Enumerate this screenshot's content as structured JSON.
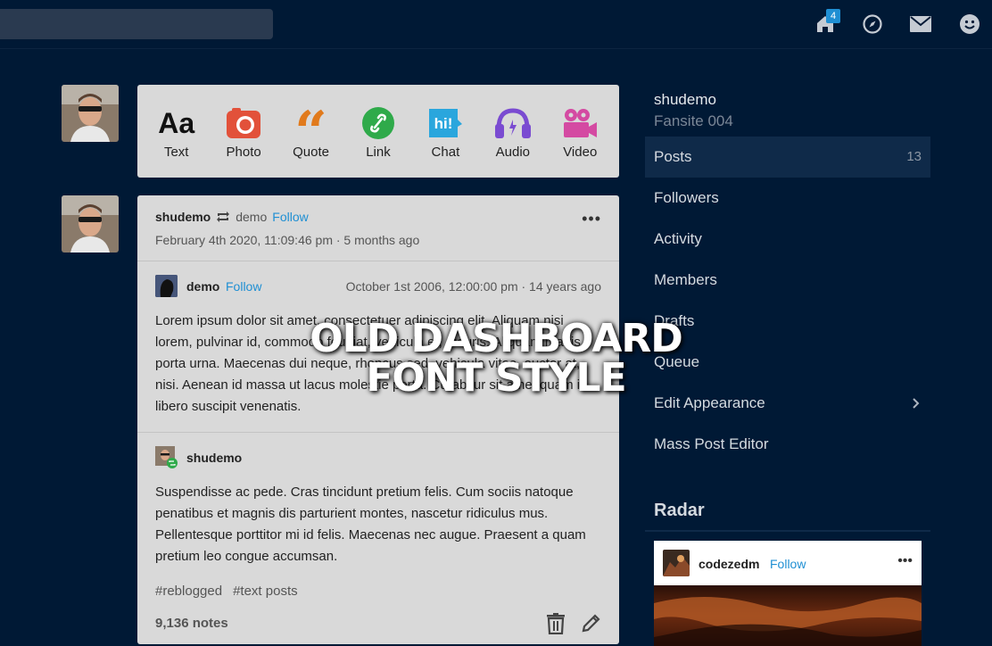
{
  "header": {
    "notification_count": "4"
  },
  "post_types": [
    {
      "label": "Text",
      "icon": "text-icon",
      "color": "#111111"
    },
    {
      "label": "Photo",
      "icon": "camera-icon",
      "color": "#e2513a"
    },
    {
      "label": "Quote",
      "icon": "quote-icon",
      "color": "#e17a1c"
    },
    {
      "label": "Link",
      "icon": "link-icon",
      "color": "#2faa4a"
    },
    {
      "label": "Chat",
      "icon": "chat-icon",
      "color": "#2aa6dd"
    },
    {
      "label": "Audio",
      "icon": "headphones-icon",
      "color": "#7a4bd1"
    },
    {
      "label": "Video",
      "icon": "video-camera-icon",
      "color": "#d44aa2"
    }
  ],
  "post": {
    "author": "shudemo",
    "reblogged_from": "demo",
    "follow_label": "Follow",
    "timestamp": "February 4th 2020, 11:09:46 pm · 5 months ago",
    "original": {
      "author": "demo",
      "follow_label": "Follow",
      "timestamp": "October 1st 2006, 12:00:00 pm · 14 years ago",
      "body": "Lorem ipsum dolor sit amet, consectetuer adipiscing elit. Aliquam nisi lorem, pulvinar id, commodo feugiat, vehicula et, mauris. Aliquam mattis porta urna. Maecenas dui neque, rhoncus sed, vehicula vitae, auctor at, nisi. Aenean id massa ut lacus molestie porta. Curabitur sit amet quam id libero suscipit venenatis."
    },
    "reblog": {
      "author": "shudemo",
      "body": "Suspendisse ac pede. Cras tincidunt pretium felis. Cum sociis natoque penatibus et magnis dis parturient montes, nascetur ridiculus mus. Pellentesque porttitor mi id felis. Maecenas nec augue. Praesent a quam pretium leo congue accumsan."
    },
    "tags": [
      "#reblogged",
      "#text posts"
    ],
    "notes": "9,136 notes"
  },
  "sidebar": {
    "blog_name": "shudemo",
    "blog_title": "Fansite 004",
    "items": [
      {
        "label": "Posts",
        "count": "13"
      },
      {
        "label": "Followers"
      },
      {
        "label": "Activity"
      },
      {
        "label": "Members"
      },
      {
        "label": "Drafts"
      },
      {
        "label": "Queue"
      },
      {
        "label": "Edit Appearance"
      },
      {
        "label": "Mass Post Editor"
      }
    ],
    "radar_title": "Radar",
    "radar": {
      "author": "codezedm",
      "follow_label": "Follow"
    }
  },
  "overlay": {
    "line1": "OLD DASHBOARD",
    "line2": "FONT STYLE"
  }
}
